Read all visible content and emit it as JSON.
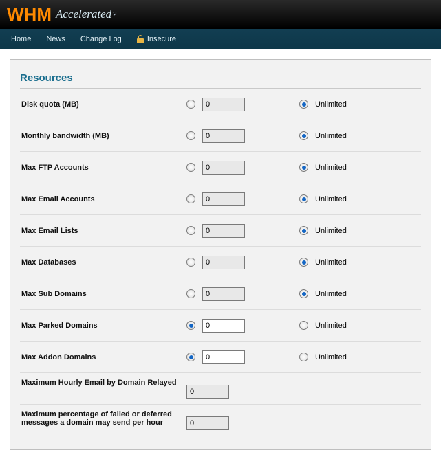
{
  "logo": {
    "main": "WHM",
    "tag": "Accelerated",
    "sub": "2"
  },
  "nav": {
    "home": "Home",
    "news": "News",
    "changelog": "Change Log",
    "insecure": "Insecure"
  },
  "section_title": "Resources",
  "unlimited_label": "Unlimited",
  "rows": [
    {
      "label": "Disk quota (MB)",
      "value": "0",
      "selected": "unlimited"
    },
    {
      "label": "Monthly bandwidth (MB)",
      "value": "0",
      "selected": "unlimited"
    },
    {
      "label": "Max FTP Accounts",
      "value": "0",
      "selected": "unlimited"
    },
    {
      "label": "Max Email Accounts",
      "value": "0",
      "selected": "unlimited"
    },
    {
      "label": "Max Email Lists",
      "value": "0",
      "selected": "unlimited"
    },
    {
      "label": "Max Databases",
      "value": "0",
      "selected": "unlimited"
    },
    {
      "label": "Max Sub Domains",
      "value": "0",
      "selected": "unlimited"
    },
    {
      "label": "Max Parked Domains",
      "value": "0",
      "selected": "value"
    },
    {
      "label": "Max Addon Domains",
      "value": "0",
      "selected": "value"
    }
  ],
  "extra": [
    {
      "label": "Maximum Hourly Email by Domain Relayed",
      "value": "0"
    },
    {
      "label": "Maximum percentage of failed or deferred messages a domain may send per hour",
      "value": "0"
    }
  ]
}
